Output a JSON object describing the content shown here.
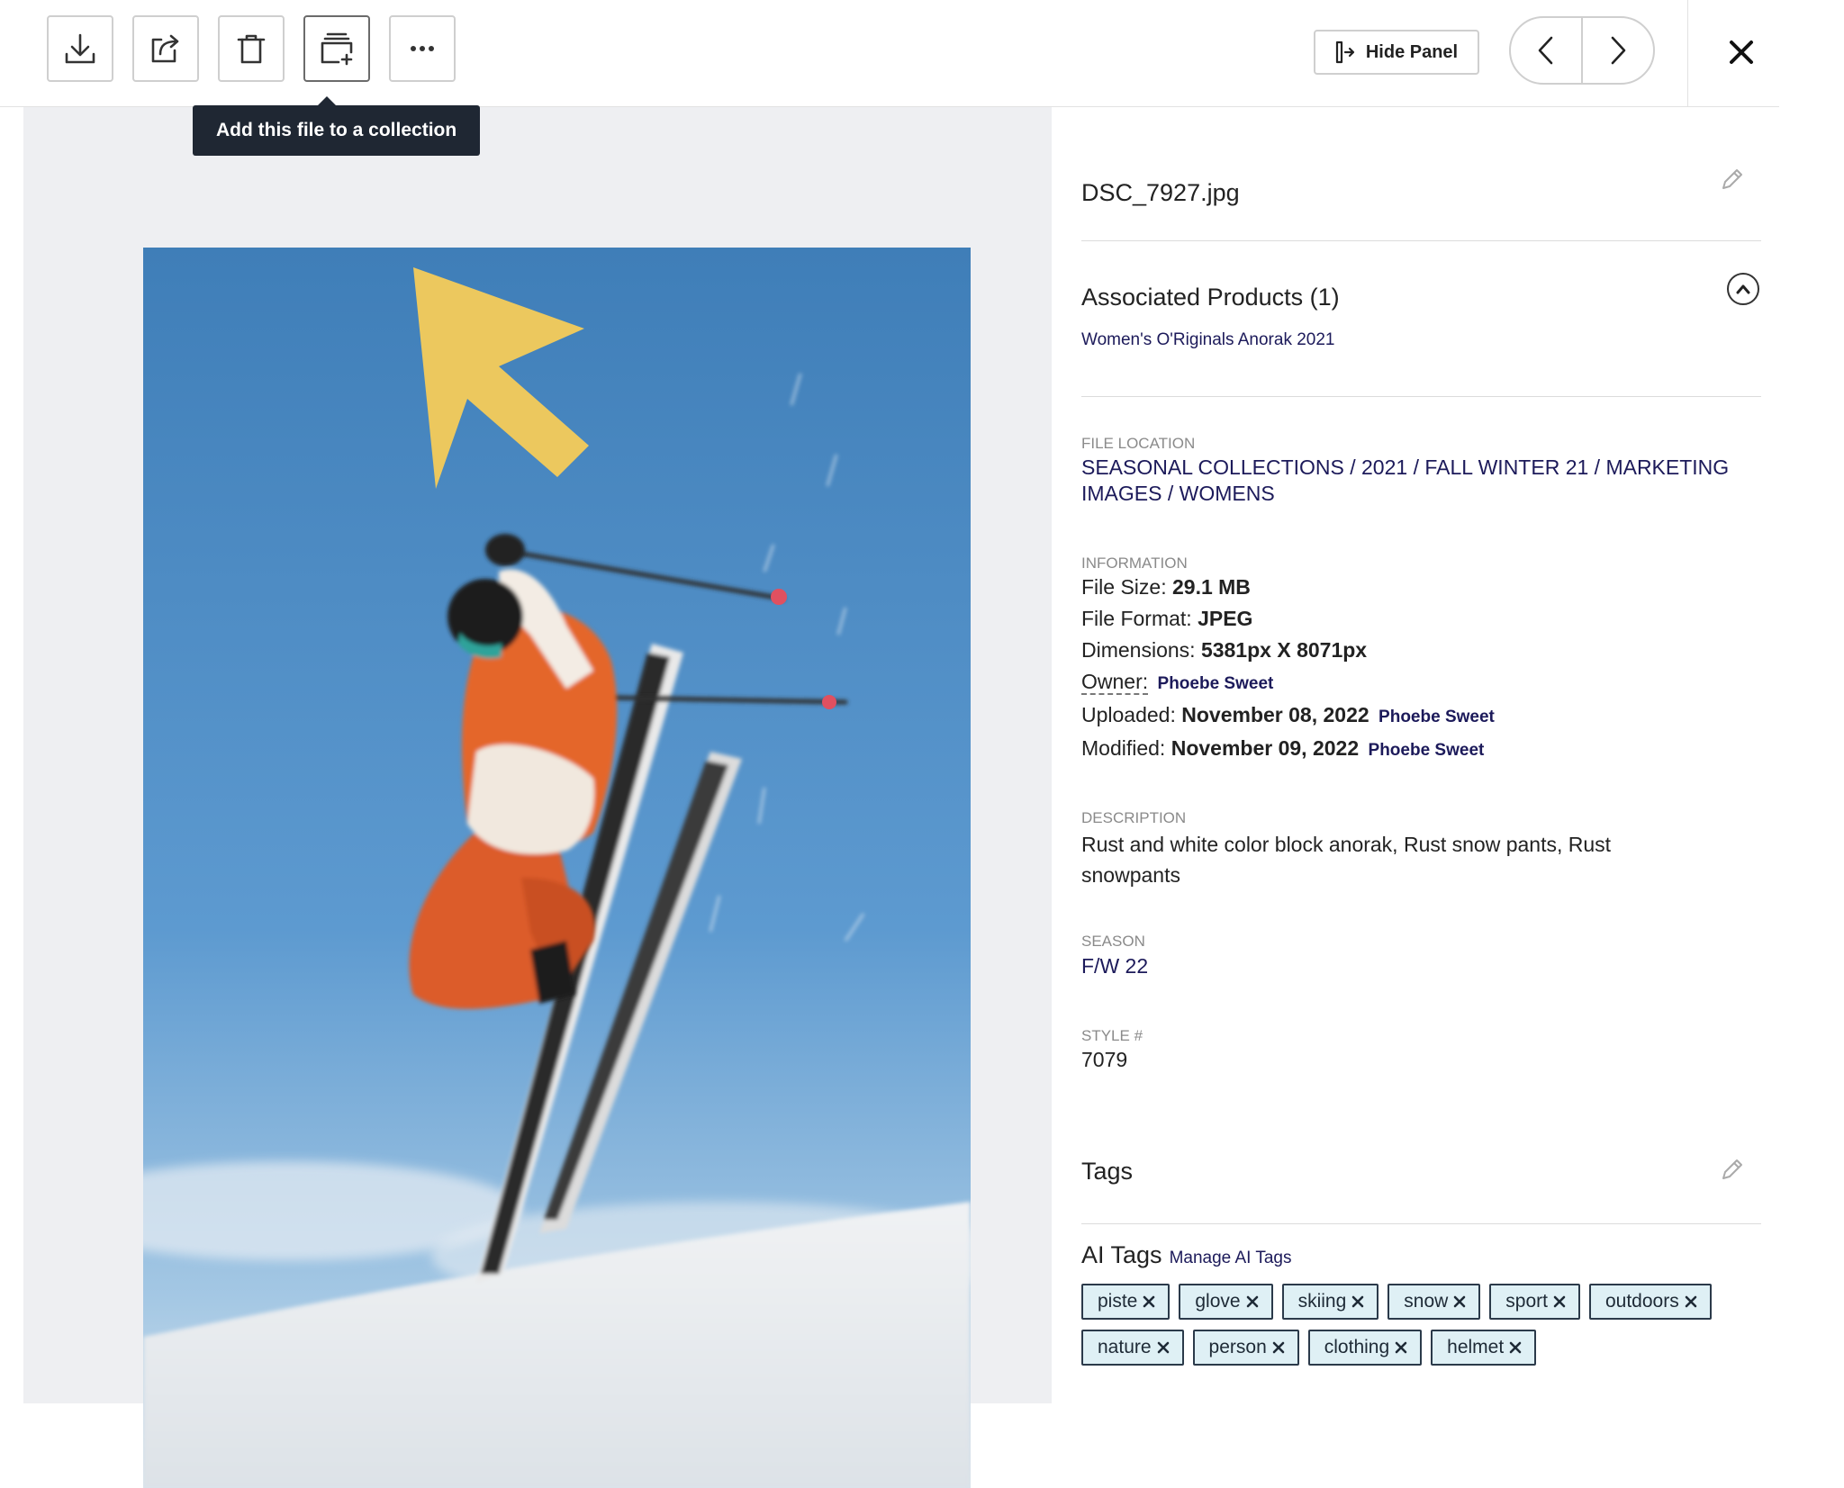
{
  "toolbar": {
    "buttons": [
      {
        "name": "download",
        "icon": "download-icon"
      },
      {
        "name": "share",
        "icon": "share-icon"
      },
      {
        "name": "delete",
        "icon": "trash-icon"
      },
      {
        "name": "add-to-collection",
        "icon": "add-collection-icon"
      },
      {
        "name": "more",
        "icon": "more-icon"
      }
    ],
    "tooltip": "Add this file to a collection",
    "hide_panel_label": "Hide Panel"
  },
  "panel": {
    "file_name": "DSC_7927.jpg",
    "associated_products": {
      "title": "Associated Products (1)",
      "items": [
        "Women's O'Riginals Anorak 2021"
      ]
    },
    "file_location": {
      "label": "FILE LOCATION",
      "path": "SEASONAL COLLECTIONS / 2021 / FALL WINTER 21 / MARKETING IMAGES / WOMENS"
    },
    "information": {
      "label": "INFORMATION",
      "file_size_label": "File Size:",
      "file_size": "29.1 MB",
      "file_format_label": "File Format:",
      "file_format": "JPEG",
      "dimensions_label": "Dimensions:",
      "dimensions": "5381px X 8071px",
      "owner_label": "Owner:",
      "owner": "Phoebe Sweet",
      "uploaded_label": "Uploaded:",
      "uploaded": "November 08, 2022",
      "uploaded_by": "Phoebe Sweet",
      "modified_label": "Modified:",
      "modified": "November 09, 2022",
      "modified_by": "Phoebe Sweet"
    },
    "description": {
      "label": "DESCRIPTION",
      "line1": "Rust and white color block anorak, Rust snow pants, Rust",
      "line2": "snowpants"
    },
    "season": {
      "label": "SEASON",
      "value": "F/W 22"
    },
    "style": {
      "label": "STYLE #",
      "value": "7079"
    },
    "tags_title": "Tags",
    "ai_tags": {
      "title": "AI Tags",
      "manage_label": "Manage AI Tags",
      "items": [
        "piste",
        "glove",
        "skiing",
        "snow",
        "sport",
        "outdoors",
        "nature",
        "person",
        "clothing",
        "helmet"
      ]
    }
  },
  "colors": {
    "accent_link": "#1c1a5a",
    "tag_bg": "#dff0f5",
    "arrow": "#ecc85e",
    "sky": "#4f8fc6",
    "jacket": "#e2622a"
  }
}
